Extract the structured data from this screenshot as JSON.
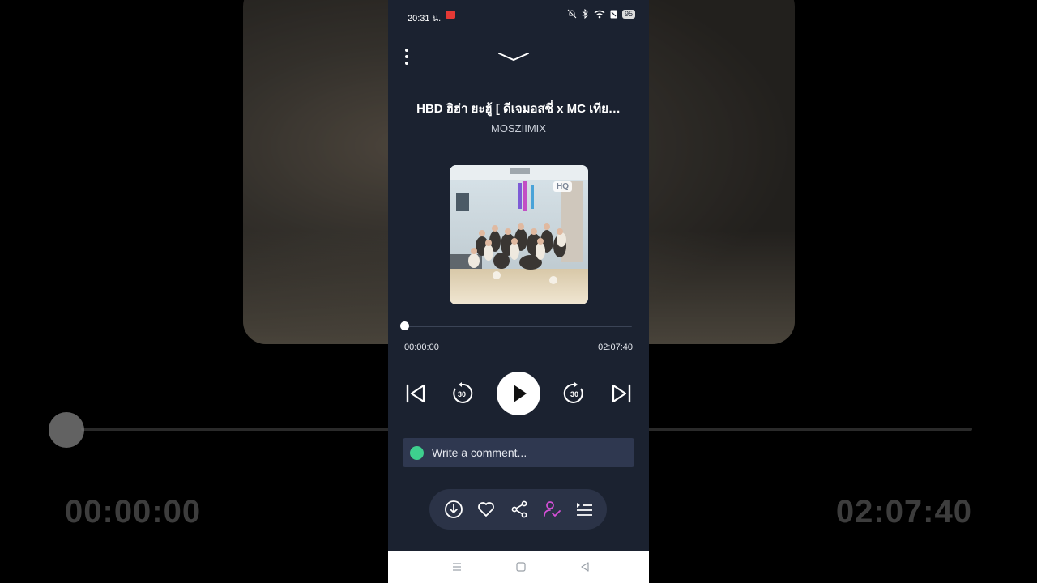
{
  "status_bar": {
    "time": "20:31 น.",
    "battery": "95"
  },
  "track": {
    "title": "HBD ฮิฮ่า ยะฮู้ [ ดีเจมอสซี่ x MC เทีย…",
    "artist": "MOSZIIMIX",
    "artwork_badge": "HQ"
  },
  "progress": {
    "current": "00:00:00",
    "total": "02:07:40",
    "fraction": 0.0
  },
  "controls": {
    "previous": "skip-previous-icon",
    "rewind": "rewind-30-icon",
    "rewind_label": "30",
    "play": "play-icon",
    "forward": "forward-30-icon",
    "forward_label": "30",
    "next": "skip-next-icon"
  },
  "comment": {
    "placeholder": "Write a comment..."
  },
  "actions": [
    "download-icon",
    "heart-icon",
    "share-icon",
    "follow-artist-icon",
    "queue-icon"
  ],
  "background": {
    "current": "00:00:00",
    "total": "02:07:40"
  },
  "colors": {
    "panel": "#1b2230",
    "accent_follow": "#d44fd6",
    "comment_bg": "#2f3850",
    "avatar": "#3ecf8e"
  }
}
